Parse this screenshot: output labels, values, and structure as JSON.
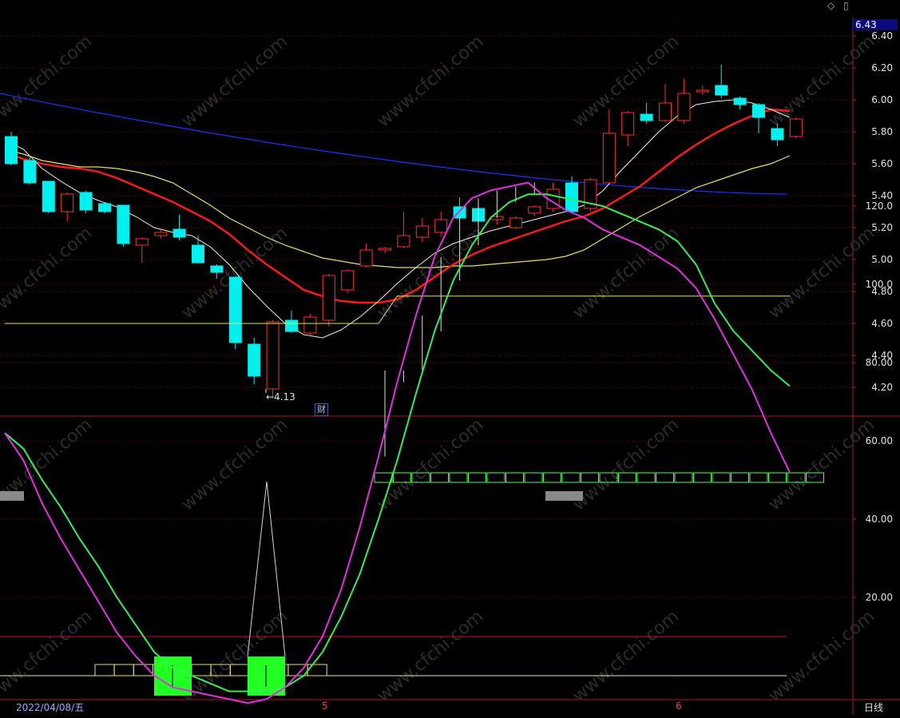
{
  "chart_data": [
    {
      "type": "candlestick",
      "current_price_label": "6.43",
      "yaxis_ticks": [
        "6.40",
        "6.20",
        "6.00",
        "5.80",
        "5.60",
        "5.40",
        "5.20",
        "5.00",
        "4.80",
        "4.60",
        "4.40",
        "4.20"
      ],
      "ylim": [
        4.05,
        6.46
      ],
      "low_annotation": "←4.13",
      "event_marker": "财",
      "candles": [
        {
          "o": 5.77,
          "h": 5.8,
          "l": 5.59,
          "c": 5.6
        },
        {
          "o": 5.62,
          "h": 5.65,
          "l": 5.47,
          "c": 5.48
        },
        {
          "o": 5.49,
          "h": 5.49,
          "l": 5.29,
          "c": 5.3
        },
        {
          "o": 5.3,
          "h": 5.42,
          "l": 5.24,
          "c": 5.41
        },
        {
          "o": 5.42,
          "h": 5.43,
          "l": 5.29,
          "c": 5.31
        },
        {
          "o": 5.35,
          "h": 5.36,
          "l": 5.29,
          "c": 5.3
        },
        {
          "o": 5.34,
          "h": 5.34,
          "l": 5.08,
          "c": 5.1
        },
        {
          "o": 5.09,
          "h": 5.14,
          "l": 4.98,
          "c": 5.13
        },
        {
          "o": 5.15,
          "h": 5.19,
          "l": 5.13,
          "c": 5.17
        },
        {
          "o": 5.19,
          "h": 5.28,
          "l": 5.12,
          "c": 5.14
        },
        {
          "o": 5.09,
          "h": 5.15,
          "l": 4.98,
          "c": 4.98
        },
        {
          "o": 4.96,
          "h": 4.97,
          "l": 4.88,
          "c": 4.92
        },
        {
          "o": 4.89,
          "h": 4.89,
          "l": 4.44,
          "c": 4.48
        },
        {
          "o": 4.47,
          "h": 4.51,
          "l": 4.22,
          "c": 4.27
        },
        {
          "o": 4.19,
          "h": 4.62,
          "l": 4.13,
          "c": 4.61
        },
        {
          "o": 4.62,
          "h": 4.68,
          "l": 4.54,
          "c": 4.55
        },
        {
          "o": 4.54,
          "h": 4.66,
          "l": 4.52,
          "c": 4.64
        },
        {
          "o": 4.62,
          "h": 4.91,
          "l": 4.58,
          "c": 4.9
        },
        {
          "o": 4.81,
          "h": 4.94,
          "l": 4.79,
          "c": 4.93
        },
        {
          "o": 4.96,
          "h": 5.1,
          "l": 4.95,
          "c": 5.06
        },
        {
          "o": 5.06,
          "h": 5.08,
          "l": 5.04,
          "c": 5.07
        },
        {
          "o": 5.08,
          "h": 5.3,
          "l": 5.07,
          "c": 5.15
        },
        {
          "o": 5.14,
          "h": 5.26,
          "l": 5.11,
          "c": 5.21
        },
        {
          "o": 5.17,
          "h": 5.3,
          "l": 5.14,
          "c": 5.25
        },
        {
          "o": 5.33,
          "h": 5.39,
          "l": 5.25,
          "c": 5.26
        },
        {
          "o": 5.32,
          "h": 5.33,
          "l": 5.17,
          "c": 5.24
        },
        {
          "o": 5.25,
          "h": 5.28,
          "l": 5.22,
          "c": 5.27
        },
        {
          "o": 5.2,
          "h": 5.27,
          "l": 5.19,
          "c": 5.26
        },
        {
          "o": 5.29,
          "h": 5.34,
          "l": 5.27,
          "c": 5.33
        },
        {
          "o": 5.32,
          "h": 5.48,
          "l": 5.3,
          "c": 5.44
        },
        {
          "o": 5.48,
          "h": 5.52,
          "l": 5.29,
          "c": 5.3
        },
        {
          "o": 5.32,
          "h": 5.51,
          "l": 5.3,
          "c": 5.5
        },
        {
          "o": 5.48,
          "h": 5.94,
          "l": 5.48,
          "c": 5.79
        },
        {
          "o": 5.78,
          "h": 5.93,
          "l": 5.71,
          "c": 5.92
        },
        {
          "o": 5.91,
          "h": 5.98,
          "l": 5.85,
          "c": 5.87
        },
        {
          "o": 5.87,
          "h": 6.1,
          "l": 5.86,
          "c": 5.98
        },
        {
          "o": 5.87,
          "h": 6.13,
          "l": 5.85,
          "c": 6.04
        },
        {
          "o": 6.05,
          "h": 6.09,
          "l": 6.03,
          "c": 6.06
        },
        {
          "o": 6.09,
          "h": 6.22,
          "l": 6.01,
          "c": 6.03
        },
        {
          "o": 6.01,
          "h": 6.02,
          "l": 5.94,
          "c": 5.97
        },
        {
          "o": 5.97,
          "h": 5.98,
          "l": 5.79,
          "c": 5.89
        },
        {
          "o": 5.82,
          "h": 5.85,
          "l": 5.71,
          "c": 5.75
        },
        {
          "o": 5.77,
          "h": 5.89,
          "l": 5.76,
          "c": 5.88
        }
      ],
      "ma_short": [
        5.75,
        5.69,
        5.57,
        5.49,
        5.42,
        5.37,
        5.33,
        5.27,
        5.2,
        5.17,
        5.15,
        5.08,
        4.97,
        4.83,
        4.71,
        4.6,
        4.53,
        4.51,
        4.56,
        4.64,
        4.74,
        4.85,
        4.95,
        5.04,
        5.1,
        5.14,
        5.18,
        5.21,
        5.24,
        5.27,
        5.3,
        5.34,
        5.43,
        5.56,
        5.68,
        5.8,
        5.9,
        5.97,
        5.99,
        6.0,
        5.98,
        5.94,
        5.89
      ],
      "ma_mid": [
        5.67,
        5.63,
        5.6,
        5.58,
        5.57,
        5.55,
        5.51,
        5.46,
        5.41,
        5.36,
        5.3,
        5.24,
        5.16,
        5.06,
        4.97,
        4.89,
        4.81,
        4.77,
        4.74,
        4.73,
        4.73,
        4.75,
        4.81,
        4.89,
        4.97,
        5.03,
        5.08,
        5.12,
        5.16,
        5.2,
        5.24,
        5.27,
        5.32,
        5.39,
        5.46,
        5.55,
        5.64,
        5.72,
        5.79,
        5.85,
        5.9,
        5.94,
        5.93
      ],
      "ma_long": [
        5.69,
        5.66,
        5.62,
        5.6,
        5.58,
        5.58,
        5.57,
        5.55,
        5.52,
        5.48,
        5.41,
        5.34,
        5.26,
        5.2,
        5.14,
        5.09,
        5.05,
        5.01,
        4.99,
        4.97,
        4.96,
        4.95,
        4.95,
        4.95,
        4.96,
        4.96,
        4.97,
        4.98,
        4.99,
        5.0,
        5.02,
        5.06,
        5.13,
        5.2,
        5.27,
        5.33,
        5.39,
        5.45,
        5.49,
        5.53,
        5.57,
        5.6,
        5.65
      ],
      "ma_blue_start": 6.04,
      "ma_blue_end": 5.41
    },
    {
      "type": "line",
      "yaxis_ticks": [
        "120.0",
        "100.0",
        "80.00",
        "60.00",
        "40.00",
        "20.00"
      ],
      "ylim": [
        -6,
        130
      ],
      "upper_level": 100,
      "lower_level": 10,
      "base_level": 0,
      "yellow_line": [
        90,
        90,
        90,
        90,
        90,
        90,
        90,
        90,
        90,
        90,
        90,
        90,
        90,
        90,
        90,
        90,
        90,
        90,
        90,
        90,
        90,
        97,
        97,
        97,
        97,
        97,
        97,
        97,
        97,
        97,
        97,
        97,
        97,
        97,
        97,
        97,
        97,
        97,
        97,
        97,
        97,
        97,
        97
      ],
      "magenta": [
        62,
        55,
        44,
        35,
        27,
        19,
        11,
        5,
        0,
        -3,
        -4,
        -5,
        -6,
        -7,
        -6,
        -3,
        2,
        10,
        22,
        38,
        56,
        75,
        92,
        107,
        117,
        122,
        124,
        125,
        126,
        122,
        119,
        117,
        114,
        112,
        110,
        107,
        104,
        99,
        91,
        82,
        73,
        62,
        52
      ],
      "green": [
        62,
        58,
        50,
        43,
        35,
        28,
        20,
        13,
        6,
        2,
        0,
        -2,
        -4,
        -4,
        -4,
        -3,
        0,
        6,
        15,
        26,
        40,
        55,
        72,
        88,
        101,
        110,
        117,
        121,
        123,
        123,
        122,
        121,
        120,
        118,
        116,
        114,
        111,
        105,
        95,
        88,
        83,
        78,
        74
      ]
    }
  ],
  "footer": {
    "date": "2022/04/08/五",
    "month_a": "5",
    "month_b": "6",
    "period": "日线"
  },
  "watermark": "www.cfchi.com"
}
